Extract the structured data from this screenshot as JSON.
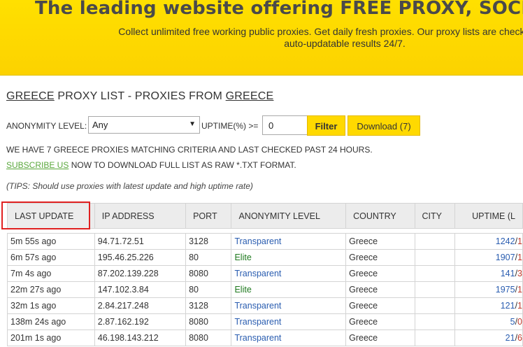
{
  "banner": {
    "title": "The leading website offering FREE PROXY, SOCKS and S",
    "subtitle_line1": "Collect unlimited free working public proxies. Get daily fresh proxies. Our proxy lists are checked in real-t",
    "subtitle_line2": "auto-updatable results 24/7."
  },
  "page_title": {
    "country1": "GREECE",
    "middle": " PROXY LIST - PROXIES FROM ",
    "country2": "GREECE"
  },
  "filters": {
    "anonymity_label": "ANONYMITY LEVEL:",
    "anonymity_value": "Any",
    "uptime_label": "UPTIME(%) >=",
    "uptime_value": "0",
    "filter_button": "Filter",
    "download_button": "Download (7)"
  },
  "info_text": "WE HAVE 7 GREECE PROXIES MATCHING CRITERIA AND LAST CHECKED PAST 24 HOURS.",
  "subscribe": {
    "link": "SUBSCRIBE US",
    "rest": " NOW TO DOWNLOAD FULL LIST AS RAW *.TXT FORMAT."
  },
  "tips": "(TIPS: Should use proxies with latest update and high uptime rate)",
  "table": {
    "headers": [
      "LAST UPDATE",
      "IP ADDRESS",
      "PORT",
      "ANONYMITY LEVEL",
      "COUNTRY",
      "CITY",
      "UPTIME (L"
    ],
    "rows": [
      {
        "last_update": "5m 55s ago",
        "ip": "94.71.72.51",
        "port": "3128",
        "anonymity": "Transparent",
        "anon_class": "transparent",
        "country": "Greece",
        "city": "",
        "up_a": "1242",
        "up_sep": "/",
        "up_b": "1"
      },
      {
        "last_update": "6m 57s ago",
        "ip": "195.46.25.226",
        "port": "80",
        "anonymity": "Elite",
        "anon_class": "elite",
        "country": "Greece",
        "city": "",
        "up_a": "1907",
        "up_sep": "/",
        "up_b": "1"
      },
      {
        "last_update": "7m 4s ago",
        "ip": "87.202.139.228",
        "port": "8080",
        "anonymity": "Transparent",
        "anon_class": "transparent",
        "country": "Greece",
        "city": "",
        "up_a": "141",
        "up_sep": "/",
        "up_b": "3"
      },
      {
        "last_update": "22m 27s ago",
        "ip": "147.102.3.84",
        "port": "80",
        "anonymity": "Elite",
        "anon_class": "elite",
        "country": "Greece",
        "city": "",
        "up_a": "1975",
        "up_sep": "/",
        "up_b": "1"
      },
      {
        "last_update": "32m 1s ago",
        "ip": "2.84.217.248",
        "port": "3128",
        "anonymity": "Transparent",
        "anon_class": "transparent",
        "country": "Greece",
        "city": "",
        "up_a": "121",
        "up_sep": "/",
        "up_b": "1"
      },
      {
        "last_update": "138m 24s ago",
        "ip": "2.87.162.192",
        "port": "8080",
        "anonymity": "Transparent",
        "anon_class": "transparent",
        "country": "Greece",
        "city": "",
        "up_a": "5",
        "up_sep": "/",
        "up_b": "0"
      },
      {
        "last_update": "201m 1s ago",
        "ip": "46.198.143.212",
        "port": "8080",
        "anonymity": "Transparent",
        "anon_class": "transparent",
        "country": "Greece",
        "city": "",
        "up_a": "21",
        "up_sep": "/",
        "up_b": "6"
      }
    ]
  },
  "colors": {
    "banner": "#ffe000",
    "button": "#ffd900",
    "highlight": "#e02020",
    "link_green": "#5aa83c"
  }
}
